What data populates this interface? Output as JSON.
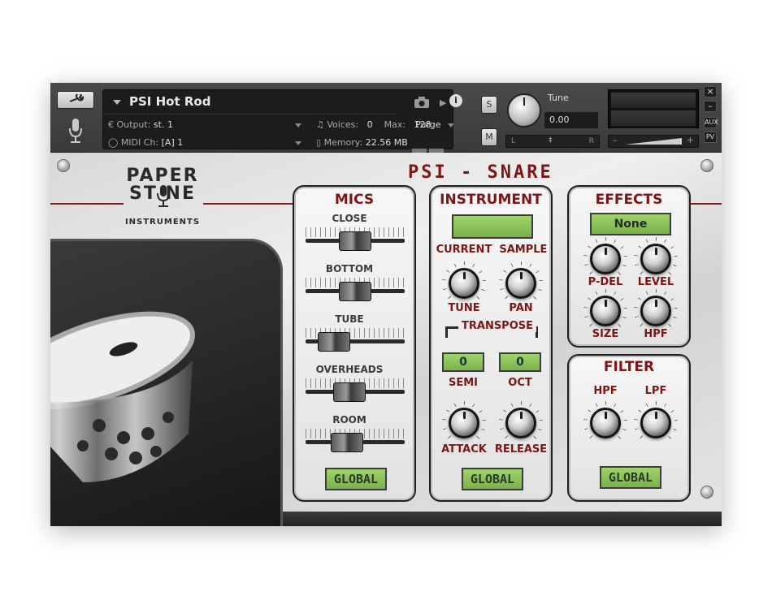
{
  "header": {
    "instrument_name": "PSI Hot Rod",
    "output_label": "Output:",
    "output_value": "st. 1",
    "midi_label": "MIDI Ch:",
    "midi_value": "[A]  1",
    "voices_label": "Voices:",
    "voices_value": "0",
    "max_label": "Max:",
    "max_value": "128",
    "memory_label": "Memory:",
    "memory_value": "22.56 MB",
    "purge_label": "Purge",
    "solo_label": "S",
    "mute_label": "M",
    "tune_label": "Tune",
    "tune_value": "0.00",
    "pan_left": "L",
    "pan_right": "R",
    "vol_minus": "–",
    "vol_plus": "+",
    "side_close": "×",
    "side_min": "–",
    "side_aux": "AUX",
    "side_pv": "PV"
  },
  "logo": {
    "line1": "PAPER",
    "line2": "ST  NE",
    "line3": "INSTRUMENTS"
  },
  "title": "PSI - SNARE",
  "mics": {
    "title": "MICS",
    "faders": [
      {
        "label": "CLOSE",
        "level": 0.5
      },
      {
        "label": "BOTTOM",
        "level": 0.5
      },
      {
        "label": "TUBE",
        "level": 0.18
      },
      {
        "label": "OVERHEADS",
        "level": 0.42
      },
      {
        "label": "ROOM",
        "level": 0.38
      }
    ],
    "global_label": "GLOBAL"
  },
  "instrument": {
    "title": "INSTRUMENT",
    "current_sample_label": "CURRENT  SAMPLE",
    "current_sample_value": "",
    "tune_label": "TUNE",
    "pan_label": "PAN",
    "transpose_label": "TRANSPOSE",
    "semi_value": "0",
    "oct_value": "0",
    "semi_label": "SEMI",
    "oct_label": "OCT",
    "attack_label": "ATTACK",
    "release_label": "RELEASE",
    "global_label": "GLOBAL"
  },
  "effects": {
    "title": "EFFECTS",
    "preset_value": "None",
    "pdel_label": "P-DEL",
    "level_label": "LEVEL",
    "size_label": "SIZE",
    "hpf_label": "HPF"
  },
  "filter": {
    "title": "FILTER",
    "hpf_label": "HPF",
    "lpf_label": "LPF",
    "global_label": "GLOBAL"
  },
  "colors": {
    "accent_red": "#7d1515",
    "lcd_green": "#8cc45a",
    "panel_bg": "#efefef"
  }
}
